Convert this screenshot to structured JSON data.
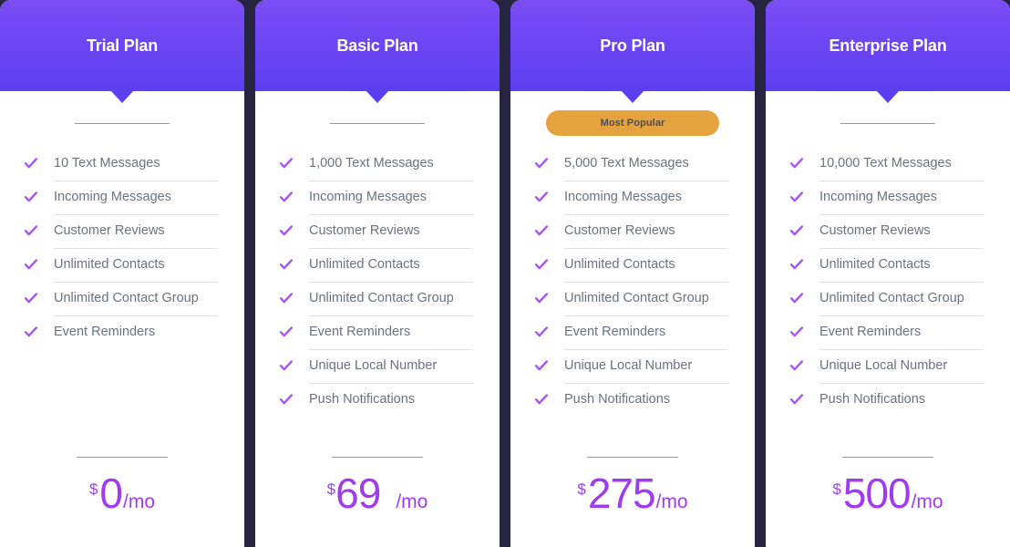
{
  "theme": {
    "background": "#262440",
    "card_background": "#ffffff",
    "header_gradient_top": "#7B4DF5",
    "header_gradient_bottom": "#5B3FF0",
    "check_color": "#A855F7",
    "feature_text_color": "#6B7280",
    "price_color": "#A03CEE",
    "badge_color": "#E5A33F",
    "badge_text_color": "#4d4d52"
  },
  "plans": [
    {
      "title": "Trial Plan",
      "badge": null,
      "features": [
        "10 Text Messages",
        "Incoming Messages",
        "Customer Reviews",
        "Unlimited Contacts",
        "Unlimited Contact Group",
        "Event Reminders"
      ],
      "price": {
        "currency": "$",
        "amount": "0",
        "period": "/mo",
        "spaced": false
      }
    },
    {
      "title": "Basic Plan",
      "badge": null,
      "features": [
        "1,000 Text Messages",
        "Incoming Messages",
        "Customer Reviews",
        "Unlimited Contacts",
        "Unlimited Contact Group",
        "Event Reminders",
        "Unique Local Number",
        "Push Notifications"
      ],
      "price": {
        "currency": "$",
        "amount": "69",
        "period": "/mo",
        "spaced": true
      }
    },
    {
      "title": "Pro Plan",
      "badge": "Most Popular",
      "features": [
        "5,000 Text Messages",
        "Incoming Messages",
        "Customer Reviews",
        "Unlimited Contacts",
        "Unlimited Contact Group",
        "Event Reminders",
        "Unique Local Number",
        "Push Notifications"
      ],
      "price": {
        "currency": "$",
        "amount": "275",
        "period": "/mo",
        "spaced": false
      }
    },
    {
      "title": "Enterprise Plan",
      "badge": null,
      "features": [
        "10,000 Text Messages",
        "Incoming Messages",
        "Customer Reviews",
        "Unlimited Contacts",
        "Unlimited Contact Group",
        "Event Reminders",
        "Unique Local Number",
        "Push Notifications"
      ],
      "price": {
        "currency": "$",
        "amount": "500",
        "period": "/mo",
        "spaced": false
      }
    }
  ],
  "icons": {
    "check": "check-icon"
  }
}
